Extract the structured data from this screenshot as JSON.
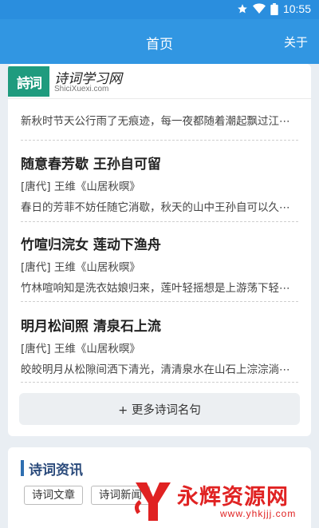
{
  "status": {
    "time": "10:55"
  },
  "header": {
    "title": "首页",
    "about": "关于"
  },
  "logo": {
    "mark": "詩词",
    "name": "诗词学习网",
    "domain": "ShiciXuexi.com"
  },
  "partial_item": {
    "desc": "新秋时节天公行雨了无痕迹，每一夜都随着潮起飘过江⋯"
  },
  "items": [
    {
      "title": "随意春芳歇 王孙自可留",
      "author": "[唐代] 王维《山居秋暝》",
      "desc": "春日的芳菲不妨任随它消歇，秋天的山中王孙自可以久⋯"
    },
    {
      "title": "竹喧归浣女 莲动下渔舟",
      "author": "[唐代] 王维《山居秋暝》",
      "desc": "竹林喧响知是洗衣姑娘归来，莲叶轻摇想是上游荡下轻⋯"
    },
    {
      "title": "明月松间照 清泉石上流",
      "author": "[唐代] 王维《山居秋暝》",
      "desc": "皎皎明月从松隙间洒下清光，清清泉水在山石上淙淙淌⋯"
    }
  ],
  "more_button": "+ 更多诗词名句",
  "news": {
    "title": "诗词资讯",
    "tags": [
      "诗词文章",
      "诗词新闻"
    ]
  },
  "watermark": {
    "text": "永辉资源网",
    "url": "www.yhkjjj.com"
  }
}
